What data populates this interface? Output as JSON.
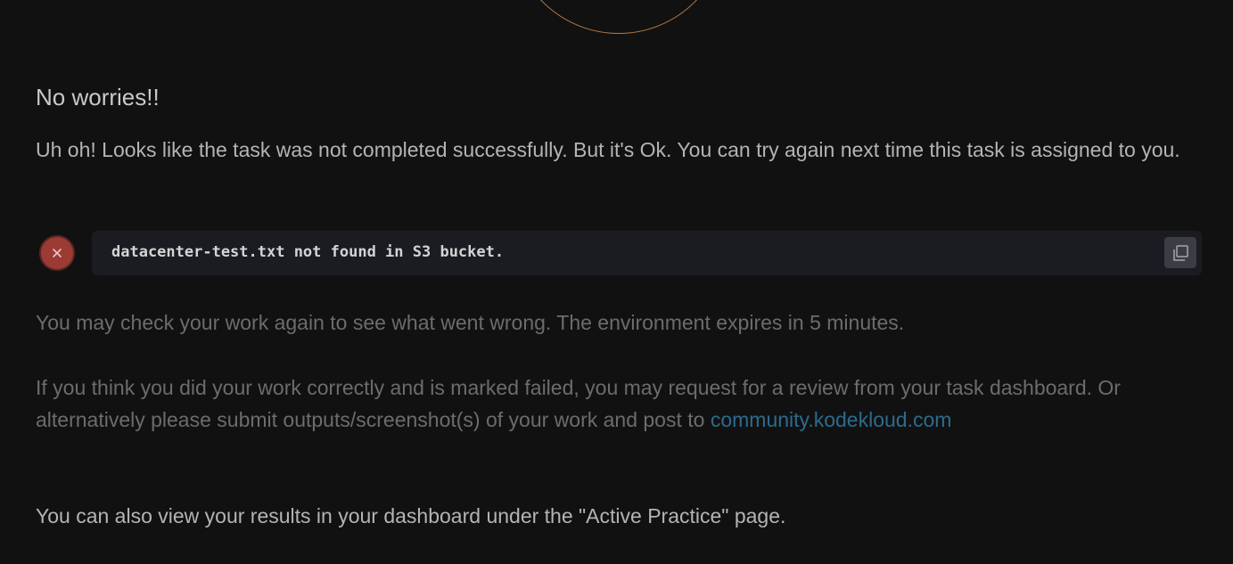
{
  "result": {
    "heading": "No worries!!",
    "intro": "Uh oh! Looks like the task was not completed successfully. But it's Ok. You can try again next time this task is assigned to you.",
    "error_message": "datacenter-test.txt not found in S3 bucket.",
    "status_icon": "close-icon",
    "copy_icon": "copy-icon"
  },
  "info": {
    "check_again": "You may check your work again to see what went wrong. The environment expires in 5 minutes.",
    "review_text": "If you think you did your work correctly and is marked failed, you may request for a review from your task dashboard. Or alternatively please submit outputs/screenshot(s) of your work and post to",
    "community_link": "community.kodekloud.com",
    "dashboard_note": "You can also view your results in your dashboard under the \"Active Practice\" page."
  },
  "colors": {
    "background": "#111112",
    "accent_ring": "#b57c44",
    "fail_red": "#9b3b34",
    "link": "#2d6b8c"
  }
}
